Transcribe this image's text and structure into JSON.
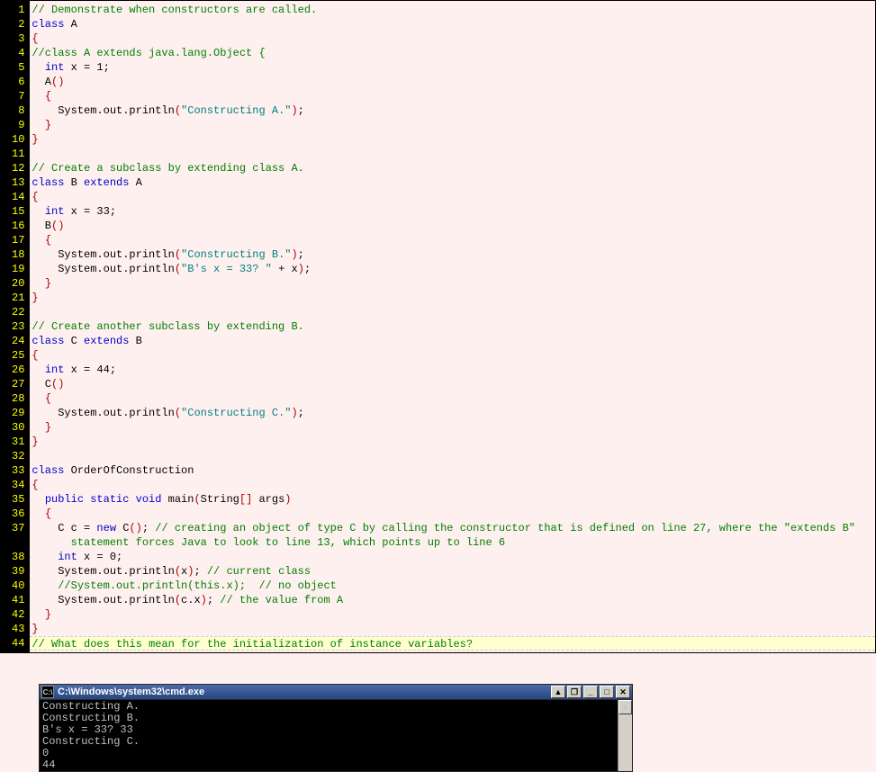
{
  "gutter": {
    "start": 1,
    "end": 44
  },
  "code": {
    "l1": [
      [
        "c-comment",
        "// Demonstrate when constructors are called."
      ]
    ],
    "l2": [
      [
        "c-keyword",
        "class"
      ],
      [
        "",
        " A"
      ]
    ],
    "l3": [
      [
        "c-paren",
        "{"
      ]
    ],
    "l4": [
      [
        "c-comment",
        "//class A extends java.lang.Object {"
      ]
    ],
    "l5": [
      [
        "",
        "  "
      ],
      [
        "c-keyword",
        "int"
      ],
      [
        "",
        " x = 1;"
      ]
    ],
    "l6": [
      [
        "",
        "  A"
      ],
      [
        "c-paren",
        "()"
      ]
    ],
    "l7": [
      [
        "",
        "  "
      ],
      [
        "c-paren",
        "{"
      ]
    ],
    "l8": [
      [
        "",
        "    System.out.println"
      ],
      [
        "c-paren",
        "("
      ],
      [
        "c-string",
        "\"Constructing A.\""
      ],
      [
        "c-paren",
        ")"
      ],
      [
        "",
        ";"
      ]
    ],
    "l9": [
      [
        "",
        "  "
      ],
      [
        "c-paren",
        "}"
      ]
    ],
    "l10": [
      [
        "c-paren",
        "}"
      ]
    ],
    "l11": [
      [
        "",
        ""
      ]
    ],
    "l12": [
      [
        "c-comment",
        "// Create a subclass by extending class A."
      ]
    ],
    "l13": [
      [
        "c-keyword",
        "class"
      ],
      [
        "",
        " B "
      ],
      [
        "c-keyword",
        "extends"
      ],
      [
        "",
        " A"
      ]
    ],
    "l14": [
      [
        "c-paren",
        "{"
      ]
    ],
    "l15": [
      [
        "",
        "  "
      ],
      [
        "c-keyword",
        "int"
      ],
      [
        "",
        " x = 33;"
      ]
    ],
    "l16": [
      [
        "",
        "  B"
      ],
      [
        "c-paren",
        "()"
      ]
    ],
    "l17": [
      [
        "",
        "  "
      ],
      [
        "c-paren",
        "{"
      ]
    ],
    "l18": [
      [
        "",
        "    System.out.println"
      ],
      [
        "c-paren",
        "("
      ],
      [
        "c-string",
        "\"Constructing B.\""
      ],
      [
        "c-paren",
        ")"
      ],
      [
        "",
        ";"
      ]
    ],
    "l19": [
      [
        "",
        "    System.out.println"
      ],
      [
        "c-paren",
        "("
      ],
      [
        "c-string",
        "\"B's x = 33? \""
      ],
      [
        "",
        " + x"
      ],
      [
        "c-paren",
        ")"
      ],
      [
        "",
        ";"
      ]
    ],
    "l20": [
      [
        "",
        "  "
      ],
      [
        "c-paren",
        "}"
      ]
    ],
    "l21": [
      [
        "c-paren",
        "}"
      ]
    ],
    "l22": [
      [
        "",
        ""
      ]
    ],
    "l23": [
      [
        "c-comment",
        "// Create another subclass by extending B."
      ]
    ],
    "l24": [
      [
        "c-keyword",
        "class"
      ],
      [
        "",
        " C "
      ],
      [
        "c-keyword",
        "extends"
      ],
      [
        "",
        " B"
      ]
    ],
    "l25": [
      [
        "c-paren",
        "{"
      ]
    ],
    "l26": [
      [
        "",
        "  "
      ],
      [
        "c-keyword",
        "int"
      ],
      [
        "",
        " x = 44;"
      ]
    ],
    "l27": [
      [
        "",
        "  C"
      ],
      [
        "c-paren",
        "()"
      ]
    ],
    "l28": [
      [
        "",
        "  "
      ],
      [
        "c-paren",
        "{"
      ]
    ],
    "l29": [
      [
        "",
        "    System.out.println"
      ],
      [
        "c-paren",
        "("
      ],
      [
        "c-string",
        "\"Constructing C.\""
      ],
      [
        "c-paren",
        ")"
      ],
      [
        "",
        ";"
      ]
    ],
    "l30": [
      [
        "",
        "  "
      ],
      [
        "c-paren",
        "}"
      ]
    ],
    "l31": [
      [
        "c-paren",
        "}"
      ]
    ],
    "l32": [
      [
        "",
        ""
      ]
    ],
    "l33": [
      [
        "c-keyword",
        "class"
      ],
      [
        "",
        " OrderOfConstruction"
      ]
    ],
    "l34": [
      [
        "c-paren",
        "{"
      ]
    ],
    "l35": [
      [
        "",
        "  "
      ],
      [
        "c-keyword",
        "public static void"
      ],
      [
        "",
        " main"
      ],
      [
        "c-paren",
        "("
      ],
      [
        "",
        "String"
      ],
      [
        "c-bracket",
        "[]"
      ],
      [
        "",
        " args"
      ],
      [
        "c-paren",
        ")"
      ]
    ],
    "l36": [
      [
        "",
        "  "
      ],
      [
        "c-paren",
        "{"
      ]
    ],
    "l37": [
      [
        "",
        "    C c = "
      ],
      [
        "c-keyword",
        "new"
      ],
      [
        "",
        " C"
      ],
      [
        "c-paren",
        "()"
      ],
      [
        "",
        "; "
      ],
      [
        "c-comment",
        "// creating an object of type C by calling the constructor that is defined on line 27, where the \"extends B\" statement forces Java to look to line 13, which points up to line 6"
      ]
    ],
    "l38": [
      [
        "",
        "    "
      ],
      [
        "c-keyword",
        "int"
      ],
      [
        "",
        " x = 0;"
      ]
    ],
    "l39": [
      [
        "",
        "    System.out.println"
      ],
      [
        "c-paren",
        "("
      ],
      [
        "",
        "x"
      ],
      [
        "c-paren",
        ")"
      ],
      [
        "",
        "; "
      ],
      [
        "c-comment",
        "// current class"
      ]
    ],
    "l40": [
      [
        "",
        "    "
      ],
      [
        "c-comment",
        "//System.out.println(this.x);  // no object"
      ]
    ],
    "l41": [
      [
        "",
        "    System.out.println"
      ],
      [
        "c-paren",
        "("
      ],
      [
        "",
        "c.x"
      ],
      [
        "c-paren",
        ")"
      ],
      [
        "",
        "; "
      ],
      [
        "c-comment",
        "// the value from A"
      ]
    ],
    "l42": [
      [
        "",
        "  "
      ],
      [
        "c-paren",
        "}"
      ]
    ],
    "l43": [
      [
        "c-paren",
        "}"
      ]
    ],
    "l44": [
      [
        "c-comment",
        "// What does this mean for the initialization of instance variables?"
      ]
    ]
  },
  "highlight_line": 44,
  "wrap_indent": "      ",
  "console": {
    "title": "C:\\Windows\\system32\\cmd.exe",
    "icon_text": "C:\\",
    "lines": [
      "Constructing A.",
      "Constructing B.",
      "B's x = 33? 33",
      "Constructing C.",
      "0",
      "44"
    ],
    "buttons": {
      "up": "▲",
      "restore": "❐",
      "min": "_",
      "max": "□",
      "close": "✕",
      "scroll_up": "▲"
    }
  }
}
